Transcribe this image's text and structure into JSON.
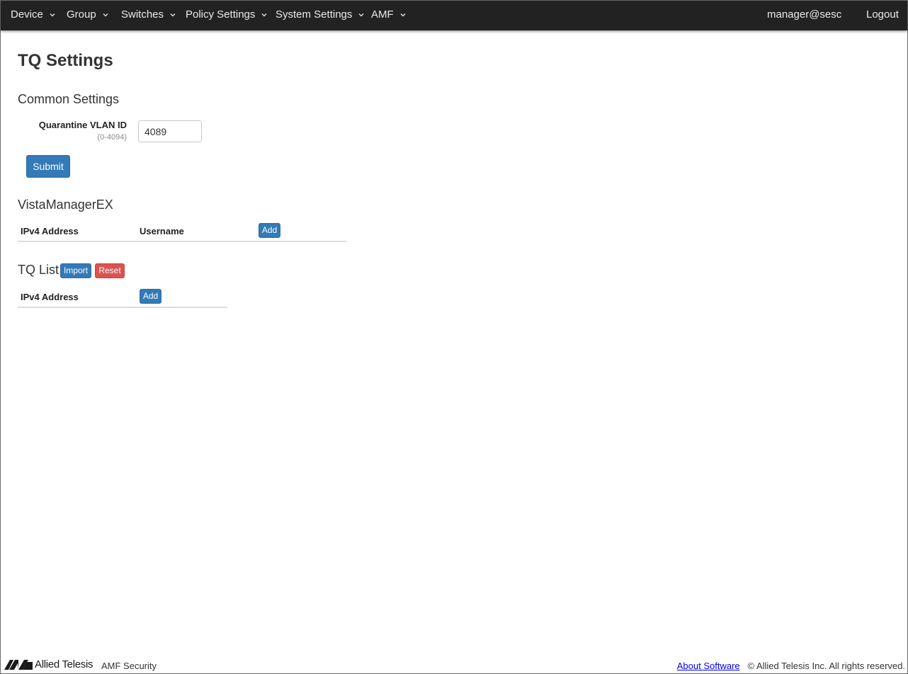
{
  "navbar": {
    "menus": [
      {
        "label": "Device"
      },
      {
        "label": "Group"
      },
      {
        "label": "Switches"
      },
      {
        "label": "Policy Settings"
      },
      {
        "label": "System Settings"
      },
      {
        "label": "AMF"
      }
    ],
    "user": "manager@sesc",
    "logout": "Logout"
  },
  "page": {
    "title": "TQ Settings"
  },
  "common_settings": {
    "title": "Common Settings",
    "quarantine_vlan": {
      "label": "Quarantine VLAN ID",
      "hint": "(0-4094)",
      "value": "4089"
    },
    "submit_label": "Submit"
  },
  "vista_manager": {
    "title": "VistaManagerEX",
    "columns": [
      "IPv4 Address",
      "Username"
    ],
    "add_label": "Add"
  },
  "tq_list": {
    "title": "TQ List",
    "import_label": "Import",
    "reset_label": "Reset",
    "columns": [
      "IPv4 Address"
    ],
    "add_label": "Add"
  },
  "footer": {
    "brand": "Allied Telesis",
    "product": "AMF Security",
    "about_link": "About Software",
    "copyright": "© Allied Telesis Inc. All rights reserved."
  },
  "colors": {
    "navbar_bg": "#222222",
    "primary": "#337ab7",
    "danger": "#d9534f"
  },
  "icons": {
    "menu_dropdown": "chevron-down-icon",
    "brand_logo": "allied-telesis-logo"
  }
}
